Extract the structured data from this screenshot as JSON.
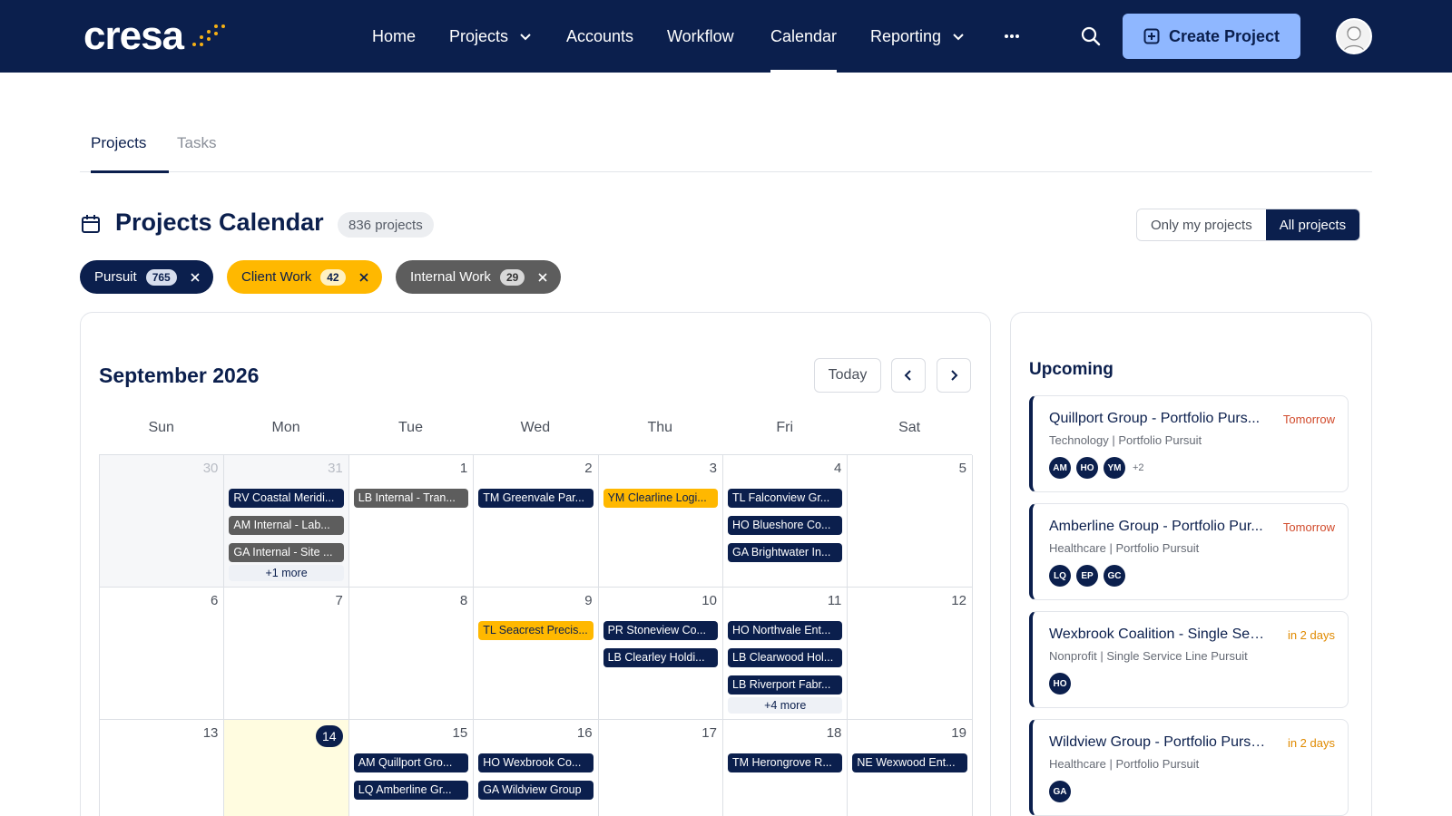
{
  "brand": {
    "logo_text": "cresa"
  },
  "nav": {
    "items": [
      {
        "label": "Home"
      },
      {
        "label": "Projects"
      },
      {
        "label": "Accounts"
      },
      {
        "label": "Workflow"
      },
      {
        "label": "Calendar"
      },
      {
        "label": "Reporting"
      }
    ],
    "more": "···",
    "create_label": "Create Project"
  },
  "tabs": [
    {
      "label": "Projects"
    },
    {
      "label": "Tasks"
    }
  ],
  "header": {
    "title": "Projects Calendar",
    "count": "836 projects",
    "toggle_mine": "Only my projects",
    "toggle_all": "All projects"
  },
  "filters": [
    {
      "label": "Pursuit",
      "count": "765"
    },
    {
      "label": "Client Work",
      "count": "42"
    },
    {
      "label": "Internal Work",
      "count": "29"
    }
  ],
  "calendar": {
    "month": "September 2026",
    "today_label": "Today",
    "weekdays": [
      "Sun",
      "Mon",
      "Tue",
      "Wed",
      "Thu",
      "Fri",
      "Sat"
    ],
    "week1": {
      "days": [
        "30",
        "31",
        "1",
        "2",
        "3",
        "4",
        "5"
      ],
      "mon_events": [
        "RV Coastal Meridi...",
        "AM Internal - Lab...",
        "GA Internal - Site ..."
      ],
      "mon_more": "+1 more",
      "tue_events": [
        "LB Internal - Tran..."
      ],
      "wed_events": [
        "TM Greenvale Par..."
      ],
      "thu_events": [
        "YM Clearline Logi..."
      ],
      "fri_events": [
        "TL Falconview Gr...",
        "HO Blueshore Co...",
        "GA Brightwater In..."
      ]
    },
    "week2": {
      "days": [
        "6",
        "7",
        "8",
        "9",
        "10",
        "11",
        "12"
      ],
      "wed_events": [
        "TL Seacrest Precis..."
      ],
      "thu_events": [
        "PR Stoneview Co...",
        "LB Clearley Holdi..."
      ],
      "fri_events": [
        "HO Northvale Ent...",
        "LB Clearwood Hol...",
        "LB Riverport Fabr..."
      ],
      "fri_more": "+4 more"
    },
    "week3": {
      "days": [
        "13",
        "14",
        "15",
        "16",
        "17",
        "18",
        "19"
      ],
      "tue_events": [
        "AM Quillport Gro...",
        "LQ Amberline Gr..."
      ],
      "wed_events": [
        "HO Wexbrook Co...",
        "GA Wildview Group"
      ],
      "fri_events": [
        "TM Herongrove R..."
      ],
      "sat_events": [
        "NE Wexwood Ent..."
      ]
    }
  },
  "upcoming": {
    "title": "Upcoming",
    "items": [
      {
        "name": "Quillport Group - Portfolio Purs...",
        "when": "Tomorrow",
        "sub": "Technology | Portfolio Pursuit",
        "avatars": [
          "AM",
          "HO",
          "YM"
        ],
        "more": "+2"
      },
      {
        "name": "Amberline Group - Portfolio Pur...",
        "when": "Tomorrow",
        "sub": "Healthcare | Portfolio Pursuit",
        "avatars": [
          "LQ",
          "EP",
          "GC"
        ]
      },
      {
        "name": "Wexbrook Coalition - Single Servi...",
        "when": "in 2 days",
        "sub": "Nonprofit | Single Service Line Pursuit",
        "avatars": [
          "HO"
        ]
      },
      {
        "name": "Wildview Group - Portfolio Pursui...",
        "when": "in 2 days",
        "sub": "Healthcare | Portfolio Pursuit",
        "avatars": [
          "GA"
        ]
      }
    ]
  },
  "colors": {
    "navy": "#0b1f4d",
    "gold": "#ffb800",
    "gray": "#5d5d5d",
    "button": "#8fb7ff",
    "today": "#fffce0"
  }
}
